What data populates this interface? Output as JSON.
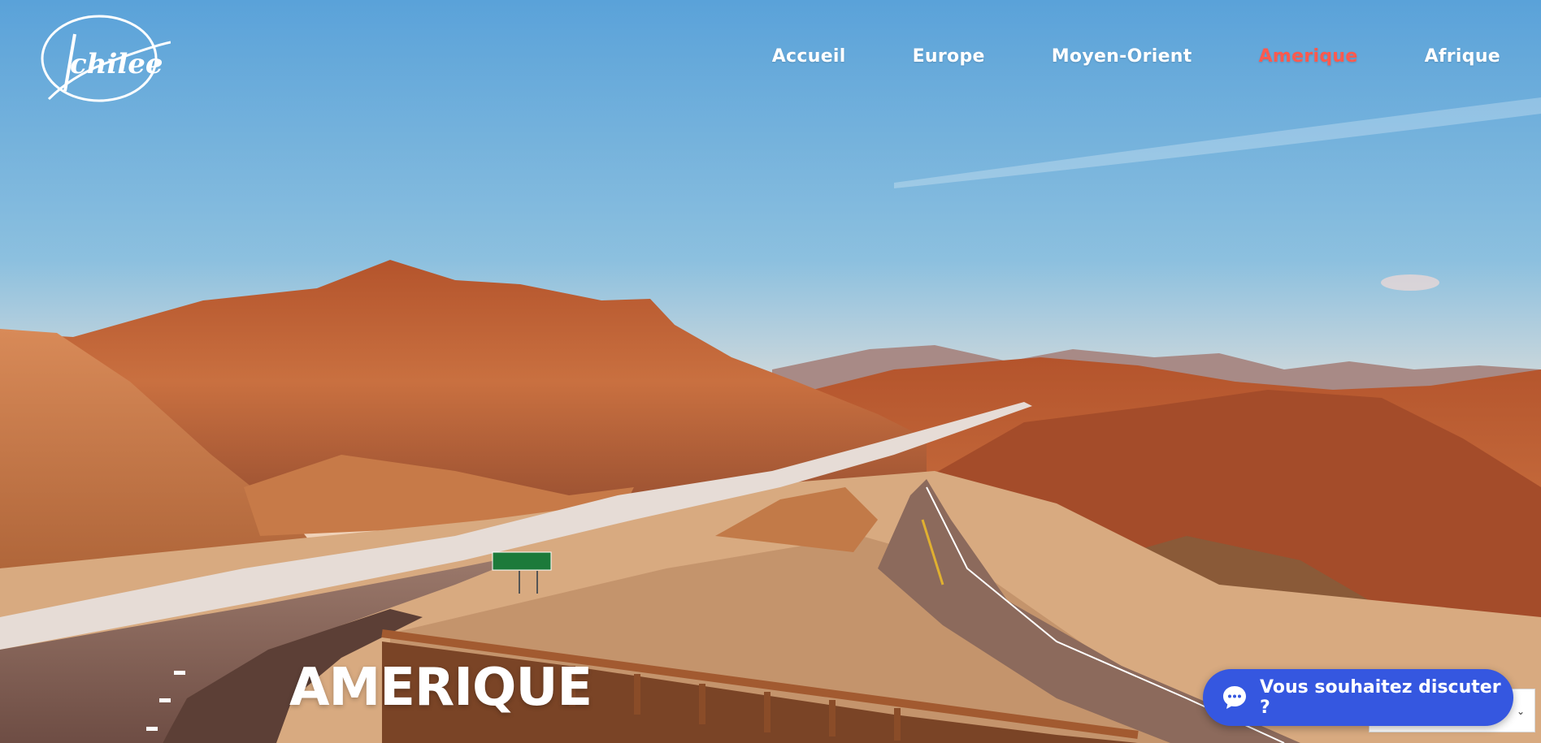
{
  "brand": {
    "logo_text": "Achilee"
  },
  "nav": {
    "items": [
      {
        "label": "Accueil",
        "active": false
      },
      {
        "label": "Europe",
        "active": false
      },
      {
        "label": "Moyen-Orient",
        "active": false
      },
      {
        "label": "Amerique",
        "active": true
      },
      {
        "label": "Afrique",
        "active": false
      }
    ],
    "active_color": "#ff5a4f"
  },
  "hero": {
    "title": "AMERIQUE"
  },
  "chat": {
    "label": "Vous souhaitez discuter ?",
    "color": "#3557e0"
  }
}
